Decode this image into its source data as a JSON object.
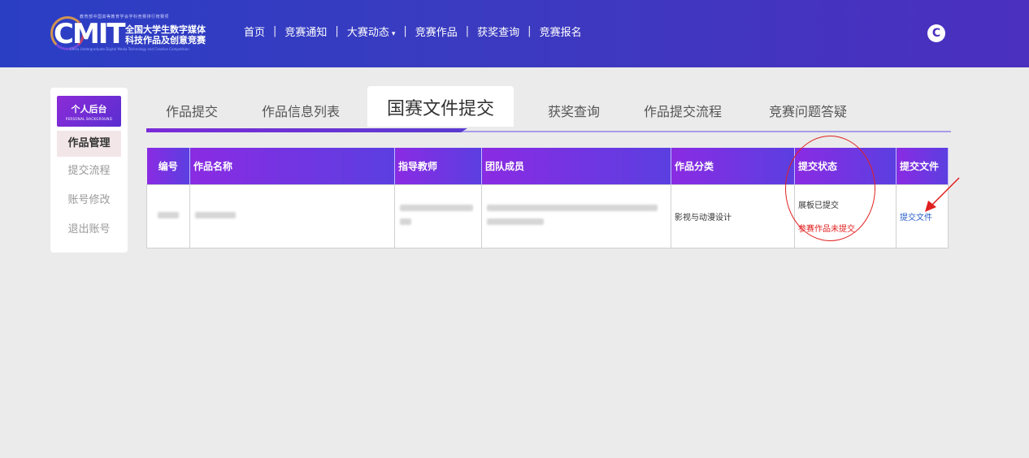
{
  "header": {
    "logo_top": "教育部中国高等教育学会学科竞赛排行榜赛项",
    "logo_cmit": "CMIT",
    "logo_line1": "全国大学生数字媒体",
    "logo_line2": "科技作品及创意竞赛",
    "logo_en": "China Undergraduate Digital Media Technology and Creative Competition",
    "nav": [
      "首页",
      "竞赛通知",
      "大赛动态",
      "竞赛作品",
      "获奖查询",
      "竞赛报名"
    ],
    "user_initial": "C"
  },
  "sidebar": {
    "head_cn": "个人后台",
    "head_en": "PERSONAL BACKGROUND",
    "items": [
      "作品管理",
      "提交流程",
      "账号修改",
      "退出账号"
    ]
  },
  "tabs": [
    "作品提交",
    "作品信息列表",
    "国赛文件提交",
    "获奖查询",
    "作品提交流程",
    "竞赛问题答疑"
  ],
  "table": {
    "headers": [
      "编号",
      "作品名称",
      "指导教师",
      "团队成员",
      "作品分类",
      "提交状态",
      "提交文件"
    ],
    "row": {
      "category": "影视与动漫设计",
      "status_done": "展板已提交",
      "status_pending": "参赛作品未提交",
      "action": "提交文件"
    }
  },
  "colors": {
    "accent": "#8a2be2",
    "header_bg": "#3a3bc0",
    "warn": "#e32020",
    "link": "#2a5fc9"
  }
}
